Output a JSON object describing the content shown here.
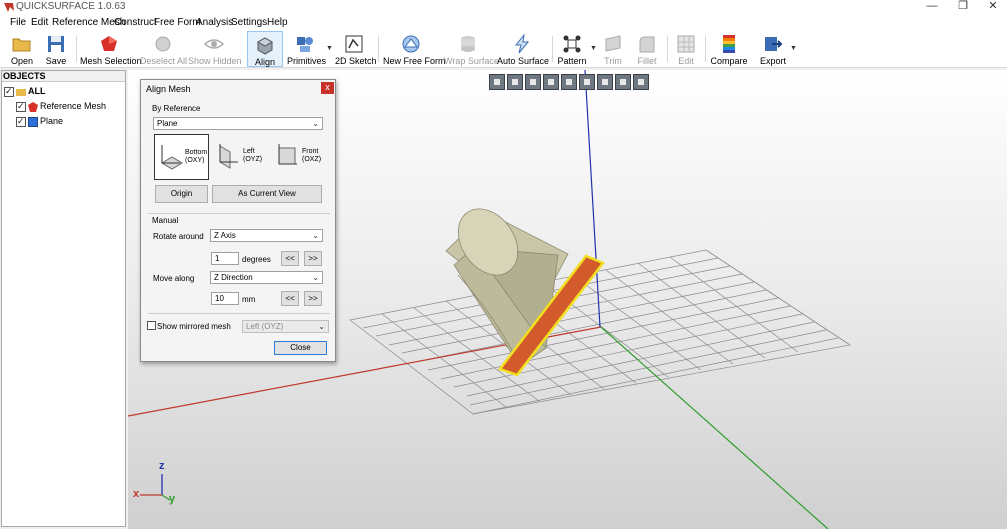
{
  "window": {
    "title": "QUICKSURFACE 1.0.63",
    "minimize": "—",
    "restore": "❐",
    "close": "✕"
  },
  "menu": [
    "File",
    "Edit",
    "Reference Mesh",
    "Construct",
    "Free Form",
    "Analysis",
    "Settings",
    "Help"
  ],
  "toolbar": {
    "open": "Open",
    "save": "Save",
    "mesh_selection": "Mesh Selection",
    "deselect_all": "Deselect All",
    "show_hidden": "Show Hidden",
    "align": "Align",
    "primitives": "Primitives",
    "sketch_2d": "2D Sketch",
    "new_free_form": "New Free Form",
    "wrap_surface": "Wrap Surface",
    "auto_surface": "Auto Surface",
    "pattern": "Pattern",
    "trim": "Trim",
    "fillet": "Fillet",
    "edit": "Edit",
    "compare": "Compare",
    "export": "Export"
  },
  "objects": {
    "header": "OBJECTS",
    "root": "ALL",
    "items": [
      "Reference Mesh",
      "Plane"
    ]
  },
  "dialog": {
    "title": "Align Mesh",
    "close_glyph": "x",
    "by_reference": "By Reference",
    "reference_type": "Plane",
    "refs": [
      {
        "name": "Bottom",
        "plane": "(OXY)"
      },
      {
        "name": "Left",
        "plane": "(OYZ)"
      },
      {
        "name": "Front",
        "plane": "(OXZ)"
      }
    ],
    "origin_button": "Origin",
    "current_view_button": "As Current View",
    "manual": "Manual",
    "rotate_around_label": "Rotate around",
    "rotate_axis": "Z Axis",
    "rotate_value": "1",
    "rotate_unit": "degrees",
    "move_along_label": "Move along",
    "move_direction": "Z Direction",
    "move_value": "10",
    "move_unit": "mm",
    "step_back": "<<",
    "step_forward": ">>",
    "show_mirrored_label": "Show mirrored mesh",
    "mirror_plane": "Left (OYZ)",
    "close_button": "Close"
  },
  "axes": {
    "x": "x",
    "y": "y",
    "z": "z",
    "x_color": "#c0392b",
    "y_color": "#2e9d2e",
    "z_color": "#2233aa"
  },
  "colors": {
    "plane_fill": "#d35a2a",
    "plane_outline": "#f0e020",
    "mesh": "#c9c6a8",
    "grid": "#8a8a8a"
  }
}
